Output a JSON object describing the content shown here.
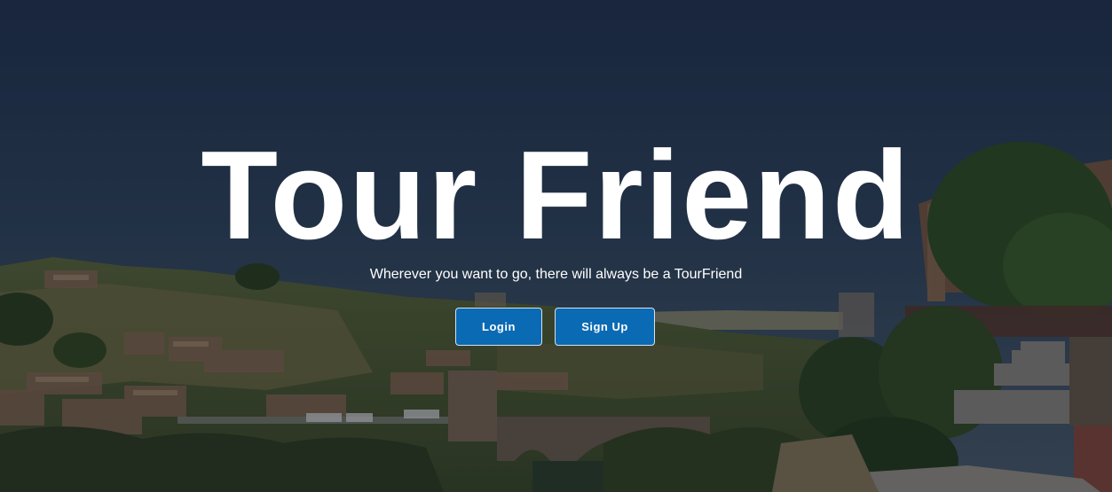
{
  "hero": {
    "title": "Tour Friend",
    "tagline": "Wherever you want to go, there will always be a TourFriend",
    "login_label": "Login",
    "signup_label": "Sign Up"
  },
  "colors": {
    "button_bg": "#0a6ab3",
    "title_text": "#ffffff",
    "sky": "#2a3a50"
  },
  "background_image": "toledo-cityscape-photo"
}
